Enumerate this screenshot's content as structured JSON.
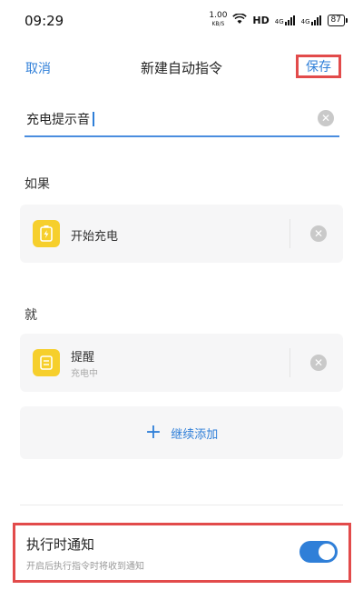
{
  "status_bar": {
    "time": "09:29",
    "net_speed_value": "1.00",
    "net_speed_unit": "KB/S",
    "hd_label": "HD",
    "signal1_label": "4G",
    "signal2_label": "4G",
    "battery_level": "87"
  },
  "nav": {
    "cancel_label": "取消",
    "title": "新建自动指令",
    "save_label": "保存"
  },
  "name_field": {
    "value": "充电提示音"
  },
  "if_section": {
    "label": "如果",
    "condition": {
      "title": "开始充电"
    }
  },
  "then_section": {
    "label": "就",
    "action": {
      "title": "提醒",
      "subtitle": "充电中"
    },
    "add_label": "继续添加"
  },
  "notify_setting": {
    "title": "执行时通知",
    "description": "开启后执行指令时将收到通知",
    "enabled": true
  },
  "colors": {
    "accent": "#2f7fd8",
    "highlight": "#e24b4b",
    "icon_yellow": "#f6cf2c"
  }
}
